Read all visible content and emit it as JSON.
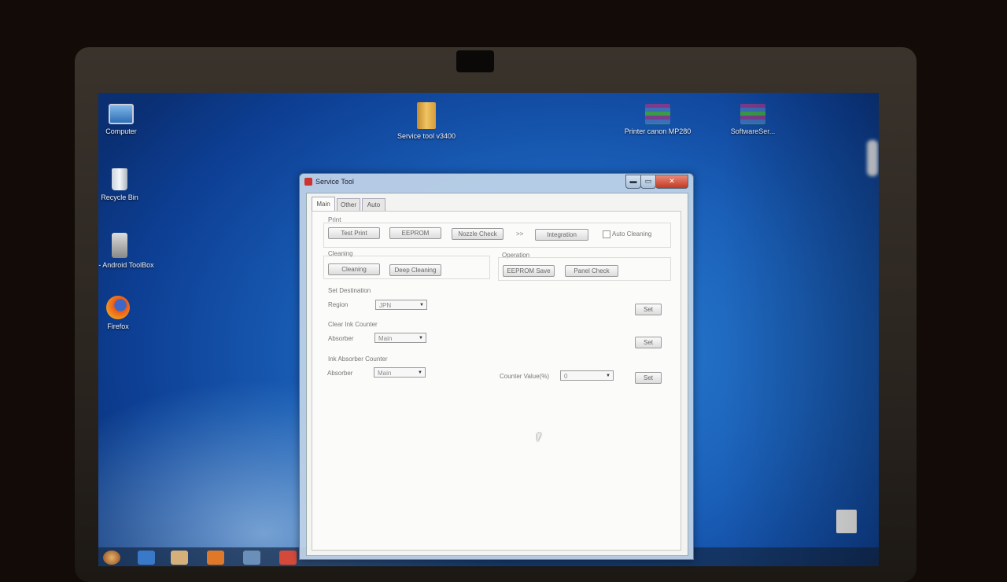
{
  "desktop": {
    "icons": [
      {
        "name": "computer-icon",
        "label": "Computer"
      },
      {
        "name": "recycle-bin-icon",
        "label": "Recycle Bin"
      },
      {
        "name": "ufi-android-toolbox-icon",
        "label": "UFI - Android ToolBox"
      },
      {
        "name": "firefox-icon",
        "label": "Firefox"
      },
      {
        "name": "service-tool-icon",
        "label": "Service tool v3400"
      },
      {
        "name": "printer-canon-icon",
        "label": "Printer canon MP280"
      },
      {
        "name": "software-icon",
        "label": "SoftwareSer..."
      }
    ]
  },
  "window": {
    "title": "Service Tool",
    "controls": {
      "minimize": "▬",
      "maximize": "▭",
      "close": "✕"
    },
    "tabs": [
      "Main",
      "Other",
      "Auto"
    ],
    "active_tab": "Main",
    "print": {
      "group_label": "Print",
      "buttons": [
        "Test Print",
        "EEPROM",
        "Nozzle Check"
      ],
      "separator": ">>",
      "integration_button": "Integration",
      "auto_cleaning_label": "Auto Cleaning",
      "auto_cleaning_checked": false
    },
    "cleaning": {
      "group_label": "Cleaning",
      "buttons": [
        "Cleaning",
        "Deep Cleaning"
      ]
    },
    "operation": {
      "group_label": "Operation",
      "buttons": [
        "EEPROM Save",
        "Panel Check"
      ]
    },
    "set_destination": {
      "group_label": "Set Destination",
      "field_label": "Region",
      "value": "JPN",
      "set_button": "Set"
    },
    "clear_ink_counter": {
      "group_label": "Clear Ink Counter",
      "field_label": "Absorber",
      "value": "Main",
      "set_button": "Set"
    },
    "ink_absorber_counter": {
      "group_label": "Ink Absorber Counter",
      "field_label": "Absorber",
      "value": "Main",
      "counter_label": "Counter Value(%)",
      "counter_value": "0",
      "set_button": "Set"
    }
  }
}
